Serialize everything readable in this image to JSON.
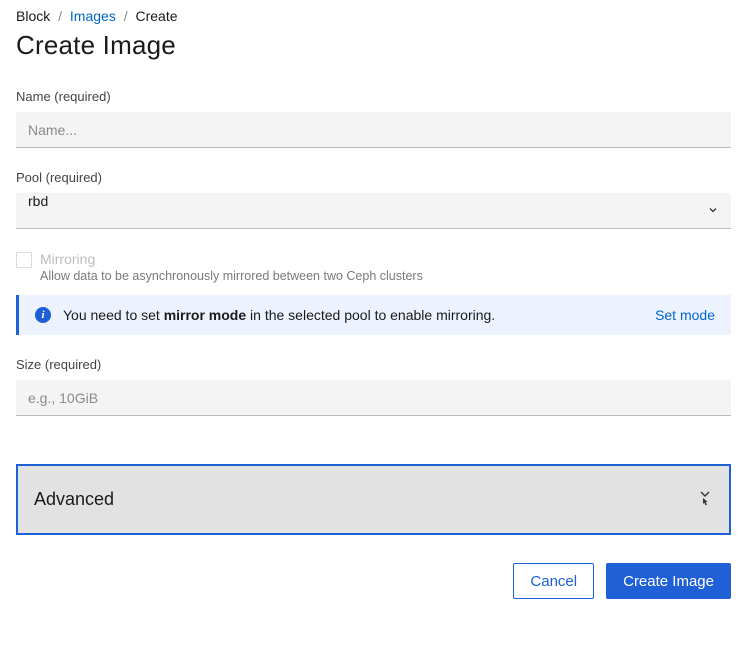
{
  "breadcrumb": {
    "item0": "Block",
    "item1": "Images",
    "item2": "Create"
  },
  "page_title": "Create Image",
  "fields": {
    "name": {
      "label": "Name (required)",
      "placeholder": "Name...",
      "value": ""
    },
    "pool": {
      "label": "Pool (required)",
      "selected": "rbd"
    },
    "mirroring": {
      "title": "Mirroring",
      "desc": "Allow data to be asynchronously mirrored between two Ceph clusters"
    },
    "size": {
      "label": "Size (required)",
      "placeholder": "e.g., 10GiB",
      "value": ""
    }
  },
  "info": {
    "text_pre": "You need to set ",
    "text_bold": "mirror mode",
    "text_post": " in the selected pool to enable mirroring.",
    "action": "Set mode"
  },
  "advanced": {
    "title": "Advanced"
  },
  "buttons": {
    "cancel": "Cancel",
    "submit": "Create Image"
  }
}
